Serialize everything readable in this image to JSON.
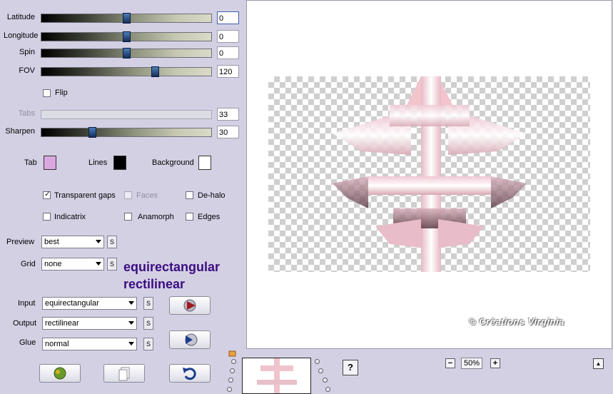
{
  "sliders": [
    {
      "label": "Latitude",
      "value": "0",
      "level": 0.5,
      "state": "focus"
    },
    {
      "label": "Longitude",
      "value": "0",
      "level": 0.5,
      "state": "normal"
    },
    {
      "label": "Spin",
      "value": "0",
      "level": 0.5,
      "state": "normal"
    },
    {
      "label": "FOV",
      "value": "120",
      "level": 0.67,
      "state": "normal"
    },
    {
      "label": "Tabs",
      "value": "33",
      "level": null,
      "state": "disabled"
    },
    {
      "label": "Sharpen",
      "value": "30",
      "level": 0.3,
      "state": "normal"
    }
  ],
  "flip": {
    "label": "Flip",
    "checked": false
  },
  "colors": {
    "tab": {
      "label": "Tab",
      "color": "#dba7e0"
    },
    "lines": {
      "label": "Lines",
      "color": "#000000"
    },
    "background": {
      "label": "Background",
      "color": "#ffffff"
    }
  },
  "options": {
    "transparent_gaps": {
      "label": "Transparent gaps",
      "checked": true
    },
    "faces": {
      "label": "Faces",
      "checked": false,
      "disabled": true
    },
    "dehalo": {
      "label": "De-halo",
      "checked": false
    },
    "indicatrix": {
      "label": "Indicatrix",
      "checked": false
    },
    "anamorph": {
      "label": "Anamorph",
      "checked": false
    },
    "edges": {
      "label": "Edges",
      "checked": false
    }
  },
  "preview": {
    "label": "Preview",
    "value": "best"
  },
  "grid": {
    "label": "Grid",
    "value": "none"
  },
  "s_glyph": "S",
  "annotation": {
    "line1": "equirectangular",
    "line2": "rectilinear"
  },
  "input": {
    "label": "Input",
    "value": "equirectangular"
  },
  "output": {
    "label": "Output",
    "value": "rectilinear"
  },
  "glue": {
    "label": "Glue",
    "value": "normal"
  },
  "watermark": "© Créations Virginia",
  "zoom": {
    "value": "50%",
    "minus": "−",
    "plus": "+"
  },
  "help": "?",
  "scroll_up": "▲",
  "accent": "#3a0d80"
}
